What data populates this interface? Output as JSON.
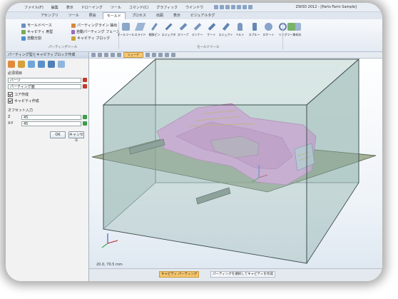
{
  "menubar": {
    "items": [
      "ファイル(F)",
      "編集",
      "表示",
      "ドローイング",
      "ツール",
      "コマンド(C)",
      "グラフィック",
      "ウインドウ"
    ],
    "window_title": "ZW3D 2012 - [Parts Farm Sample]"
  },
  "tabs": [
    "アセンブリ",
    "ツール",
    "照会",
    "モールド",
    "プロセス",
    "出図",
    "表示",
    "ビジュアルタグ"
  ],
  "active_tab": "モールド",
  "ribbon": {
    "commands": [
      {
        "label": "モールドベース",
        "color": "#6a8fc2"
      },
      {
        "label": "パーティングライン 抽出",
        "color": "#d7883a"
      },
      {
        "label": "キャビティ 用型",
        "color": "#7ba955"
      },
      {
        "label": "自動パーティング フェース",
        "color": "#9b6ac0"
      },
      {
        "label": "自動分割",
        "color": "#4d8fd1"
      },
      {
        "label": "キャビティ ブロック",
        "color": "#c9a33a"
      }
    ],
    "group_label_left": "パーティングツール",
    "tools": [
      "ホールツール",
      "スライド",
      "傾斜ピン",
      "エジェクタ",
      "スリーブ",
      "ランナー",
      "ゲート",
      "エジェクト",
      "ベルト",
      "スプルー",
      "ロケート",
      "リング",
      "冷却水"
    ],
    "group_label_tools": "モールドツール",
    "extra_button": "ツール"
  },
  "panel": {
    "title": "パーティング型とキャビティブロック作成",
    "section_required": "必須項目",
    "field_part": {
      "label": "パーツ",
      "value": ""
    },
    "field_parting": {
      "label": "パーティング面",
      "value": ""
    },
    "check1": "コア作成",
    "check2": "キャビティ作成",
    "section_input": "オフセット入力",
    "field_z": {
      "label": "Z",
      "value": "45"
    },
    "field_x": {
      "label": "X-Y",
      "value": "45"
    },
    "ok": "OK",
    "cancel": "キャンセル"
  },
  "viewport": {
    "view_label": "シェーデ",
    "coordinate_readout": "20.0, 70.5 mm"
  },
  "status": {
    "left": "キャビティ パーティング",
    "right": "パーティングを選択してキャビティを作成"
  },
  "colors": {
    "accent_orange": "#f6c66c",
    "part_pink": "#e2a5e0",
    "box_fill": "#a9c7c4",
    "parting_plane": "#8a9a78"
  }
}
